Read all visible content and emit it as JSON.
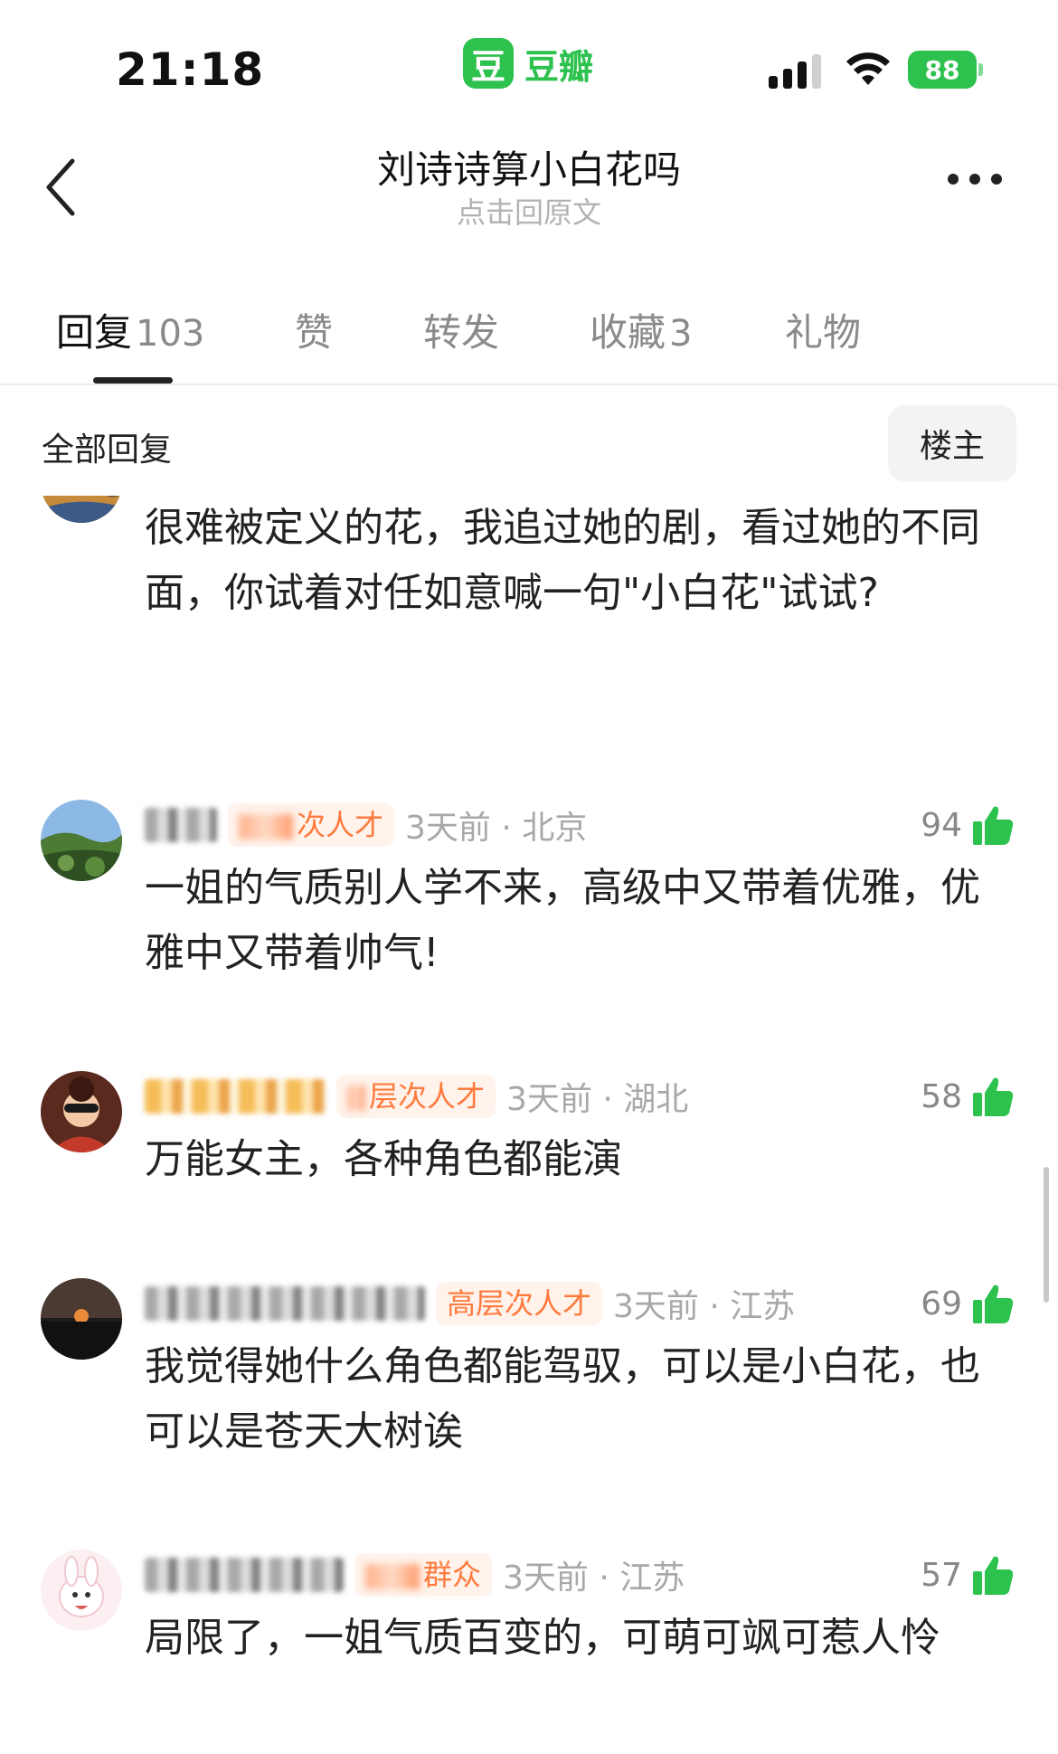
{
  "status_bar": {
    "time": "21:18",
    "app_logo_char": "豆",
    "app_name": "豆瓣",
    "battery": "88"
  },
  "nav": {
    "title": "刘诗诗算小白花吗",
    "subtitle": "点击回原文"
  },
  "tabs": [
    {
      "label": "回复",
      "count": "103",
      "active": true
    },
    {
      "label": "赞",
      "count": ""
    },
    {
      "label": "转发",
      "count": ""
    },
    {
      "label": "收藏",
      "count": "3"
    },
    {
      "label": "礼物",
      "count": ""
    }
  ],
  "filter": {
    "label": "全部回复",
    "op_button": "楼主"
  },
  "comments": [
    {
      "badge": "",
      "time": "",
      "location": "",
      "likes": "",
      "content": "很难被定义的花，我追过她的剧，看过她的不同面，你试着对任如意喊一句\"小白花\"试试?"
    },
    {
      "badge": "次人才",
      "time": "3天前 · 北京",
      "likes": "94",
      "content": "一姐的气质别人学不来，高级中又带着优雅，优雅中又带着帅气!"
    },
    {
      "badge": "层次人才",
      "time": "3天前 · 湖北",
      "likes": "58",
      "content": "万能女主，各种角色都能演"
    },
    {
      "badge": "高层次人才",
      "time": "3天前 · 江苏",
      "likes": "69",
      "content": "我觉得她什么角色都能驾驭，可以是小白花，也可以是苍天大树诶"
    },
    {
      "badge": "群众",
      "time": "3天前 · 江苏",
      "likes": "57",
      "content": "局限了，一姐气质百变的，可萌可飒可惹人怜"
    }
  ],
  "colors": {
    "accent": "#2dc14e",
    "badge_text": "#ff7a3d",
    "badge_bg": "#fff3ec"
  }
}
